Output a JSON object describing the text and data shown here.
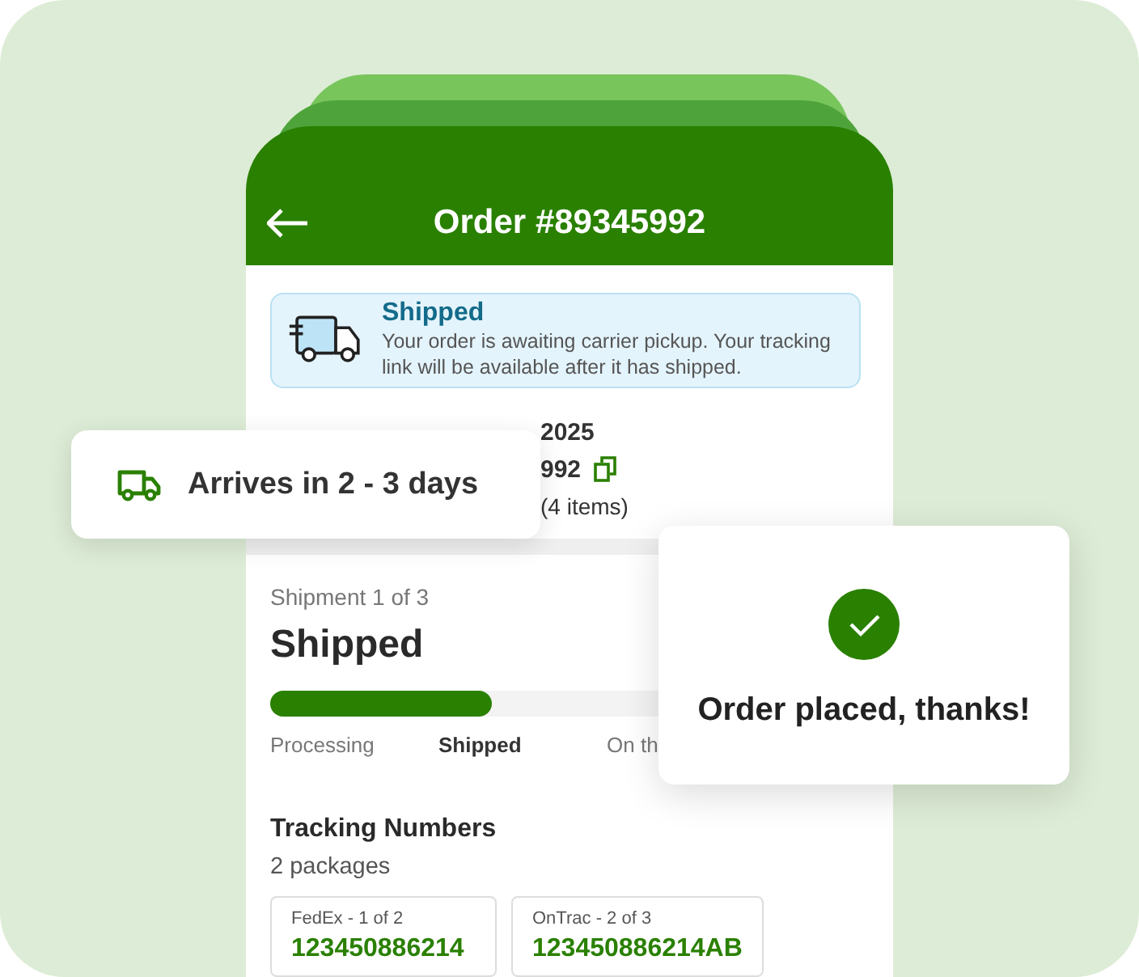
{
  "header": {
    "title": "Order #89345992"
  },
  "status_banner": {
    "title": "Shipped",
    "message": "Your order is awaiting carrier pickup. Your tracking link will be available after it has shipped."
  },
  "order_details": [
    "2025",
    "992",
    "(4 items)"
  ],
  "shipment": {
    "counter": "Shipment 1 of 3",
    "status": "Shipped",
    "progress": {
      "level": 0.37
    },
    "steps": [
      {
        "label": "Processing",
        "selected": false
      },
      {
        "label": "Shipped",
        "selected": true
      },
      {
        "label": "On th",
        "selected": false
      }
    ]
  },
  "tracking": {
    "title": "Tracking Numbers",
    "count": "2 packages",
    "packages": [
      {
        "carrier": "FedEx - 1 of 2",
        "number": "123450886214"
      },
      {
        "carrier": "OnTrac - 2 of 3",
        "number": "123450886214AB"
      }
    ]
  },
  "arrival_card": {
    "text": "Arrives in 2 - 3 days"
  },
  "confirmation_card": {
    "text": "Order placed, thanks!"
  }
}
